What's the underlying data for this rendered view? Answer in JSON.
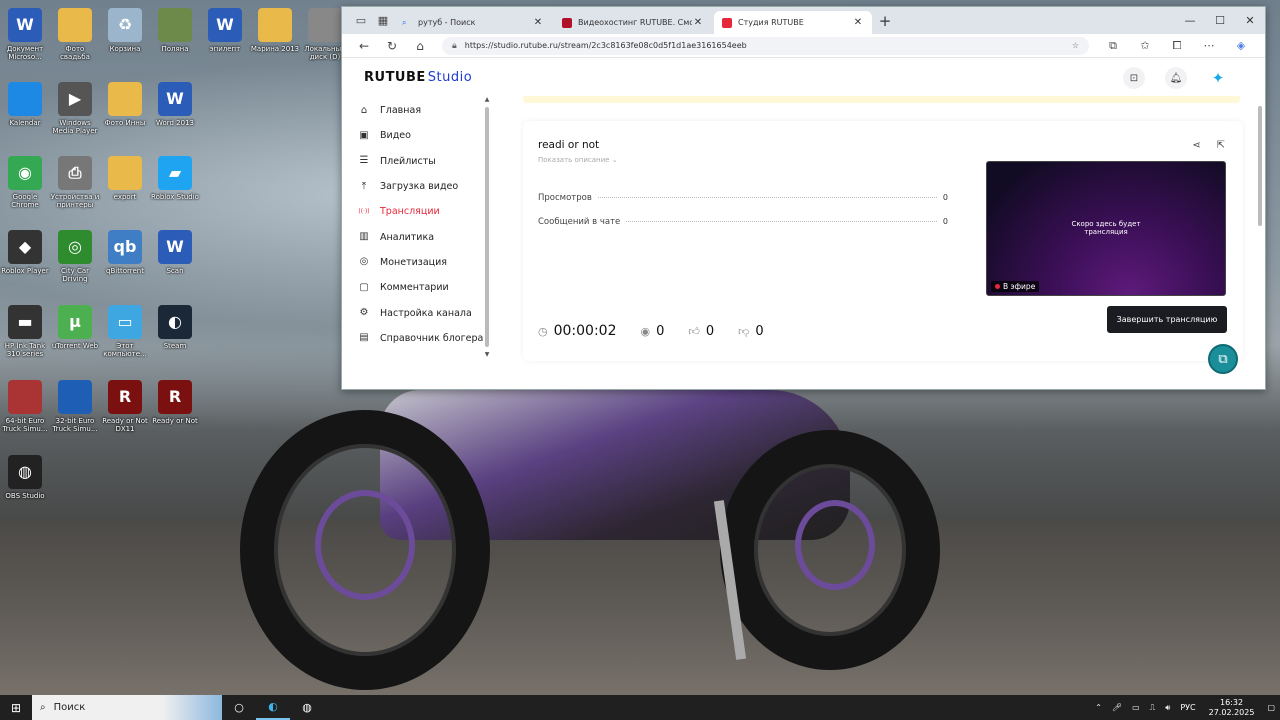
{
  "desktop": {
    "icons": [
      {
        "label": "Документ Microso...",
        "color": "#2b5cb8",
        "glyph": "W"
      },
      {
        "label": "Фото свадьба",
        "color": "#e9b949",
        "glyph": ""
      },
      {
        "label": "Корзина",
        "color": "#9bb6cc",
        "glyph": "♻"
      },
      {
        "label": "Поляна",
        "color": "#6d8a4a",
        "glyph": ""
      },
      {
        "label": "эпилепт",
        "color": "#2b5cb8",
        "glyph": "W"
      },
      {
        "label": "Марина 2013",
        "color": "#e9b949",
        "glyph": ""
      },
      {
        "label": "Локальный диск (D)",
        "color": "#888",
        "glyph": ""
      },
      {
        "label": "Kalendar",
        "color": "#1e88e5",
        "glyph": ""
      },
      {
        "label": "Windows Media Player",
        "color": "#555",
        "glyph": "▶"
      },
      {
        "label": "Фото Инны",
        "color": "#e9b949",
        "glyph": ""
      },
      {
        "label": "Word 2013",
        "color": "#2b5cb8",
        "glyph": "W"
      },
      {
        "label": "Google Chrome",
        "color": "#34a853",
        "glyph": "◉"
      },
      {
        "label": "Устройства и принтеры",
        "color": "#777",
        "glyph": "⎙"
      },
      {
        "label": "export",
        "color": "#e9b949",
        "glyph": ""
      },
      {
        "label": "Roblox Studio",
        "color": "#1ea4f0",
        "glyph": "▰"
      },
      {
        "label": "Roblox Player",
        "color": "#333",
        "glyph": "◆"
      },
      {
        "label": "City Car Driving",
        "color": "#2e8b2e",
        "glyph": "◎"
      },
      {
        "label": "qBittorrent",
        "color": "#3f7ec4",
        "glyph": "qb"
      },
      {
        "label": "Scan",
        "color": "#2b5cb8",
        "glyph": "W"
      },
      {
        "label": "HP Ink Tank 310 series",
        "color": "#333",
        "glyph": "▬"
      },
      {
        "label": "uTorrent Web",
        "color": "#4caf50",
        "glyph": "µ"
      },
      {
        "label": "Этот компьюте...",
        "color": "#3ea6e0",
        "glyph": "▭"
      },
      {
        "label": "Steam",
        "color": "#1b2838",
        "glyph": "◐"
      },
      {
        "label": "64-bit Euro Truck Simu...",
        "color": "#a33",
        "glyph": ""
      },
      {
        "label": "32-bit Euro Truck Simu...",
        "color": "#1e5fb5",
        "glyph": ""
      },
      {
        "label": "Ready or Not DX11",
        "color": "#7a1010",
        "glyph": "R"
      },
      {
        "label": "Ready or Not",
        "color": "#7a1010",
        "glyph": "R"
      },
      {
        "label": "OBS Studio",
        "color": "#222",
        "glyph": "◍"
      }
    ]
  },
  "browser": {
    "tabs": [
      {
        "title": "рутуб - Поиск",
        "fav_color": "#1a73e8",
        "fav_glyph": "🔍"
      },
      {
        "title": "Видеохостинг RUTUBE. Смотрит",
        "fav_color": "#b0102a",
        "fav_glyph": "R"
      },
      {
        "title": "Студия RUTUBE",
        "fav_color": "#e6283a",
        "fav_glyph": "▭"
      }
    ],
    "url": "https://studio.rutube.ru/stream/2c3c8163fe08c0d5f1d1ae3161654eeb"
  },
  "studio": {
    "logo_main": "RUTUBE",
    "logo_sub": "Studio",
    "nav": [
      {
        "label": "Главная",
        "icon": "⌂"
      },
      {
        "label": "Видео",
        "icon": "▣"
      },
      {
        "label": "Плейлисты",
        "icon": "☰"
      },
      {
        "label": "Загрузка видео",
        "icon": "⤒"
      },
      {
        "label": "Трансляции",
        "icon": "((·))"
      },
      {
        "label": "Аналитика",
        "icon": "▥"
      },
      {
        "label": "Монетизация",
        "icon": "◎"
      },
      {
        "label": "Комментарии",
        "icon": "▢"
      },
      {
        "label": "Настройка канала",
        "icon": "⚙"
      },
      {
        "label": "Справочник блогера",
        "icon": "▤"
      }
    ],
    "stream": {
      "title": "readi or not",
      "show_description": "Показать описание ⌄",
      "stats": [
        {
          "label": "Просмотров",
          "value": "0"
        },
        {
          "label": "Сообщений в чате",
          "value": "0"
        }
      ],
      "preview_text_1": "Скоро здесь будет",
      "preview_text_2": "трансляция",
      "live_badge": "В эфире",
      "timer": "00:00:02",
      "viewers": "0",
      "likes": "0",
      "dislikes": "0",
      "end_button": "Завершить трансляцию"
    }
  },
  "taskbar": {
    "search_placeholder": "Поиск",
    "language": "РУС",
    "time": "16:32",
    "date": "27.02.2025"
  }
}
